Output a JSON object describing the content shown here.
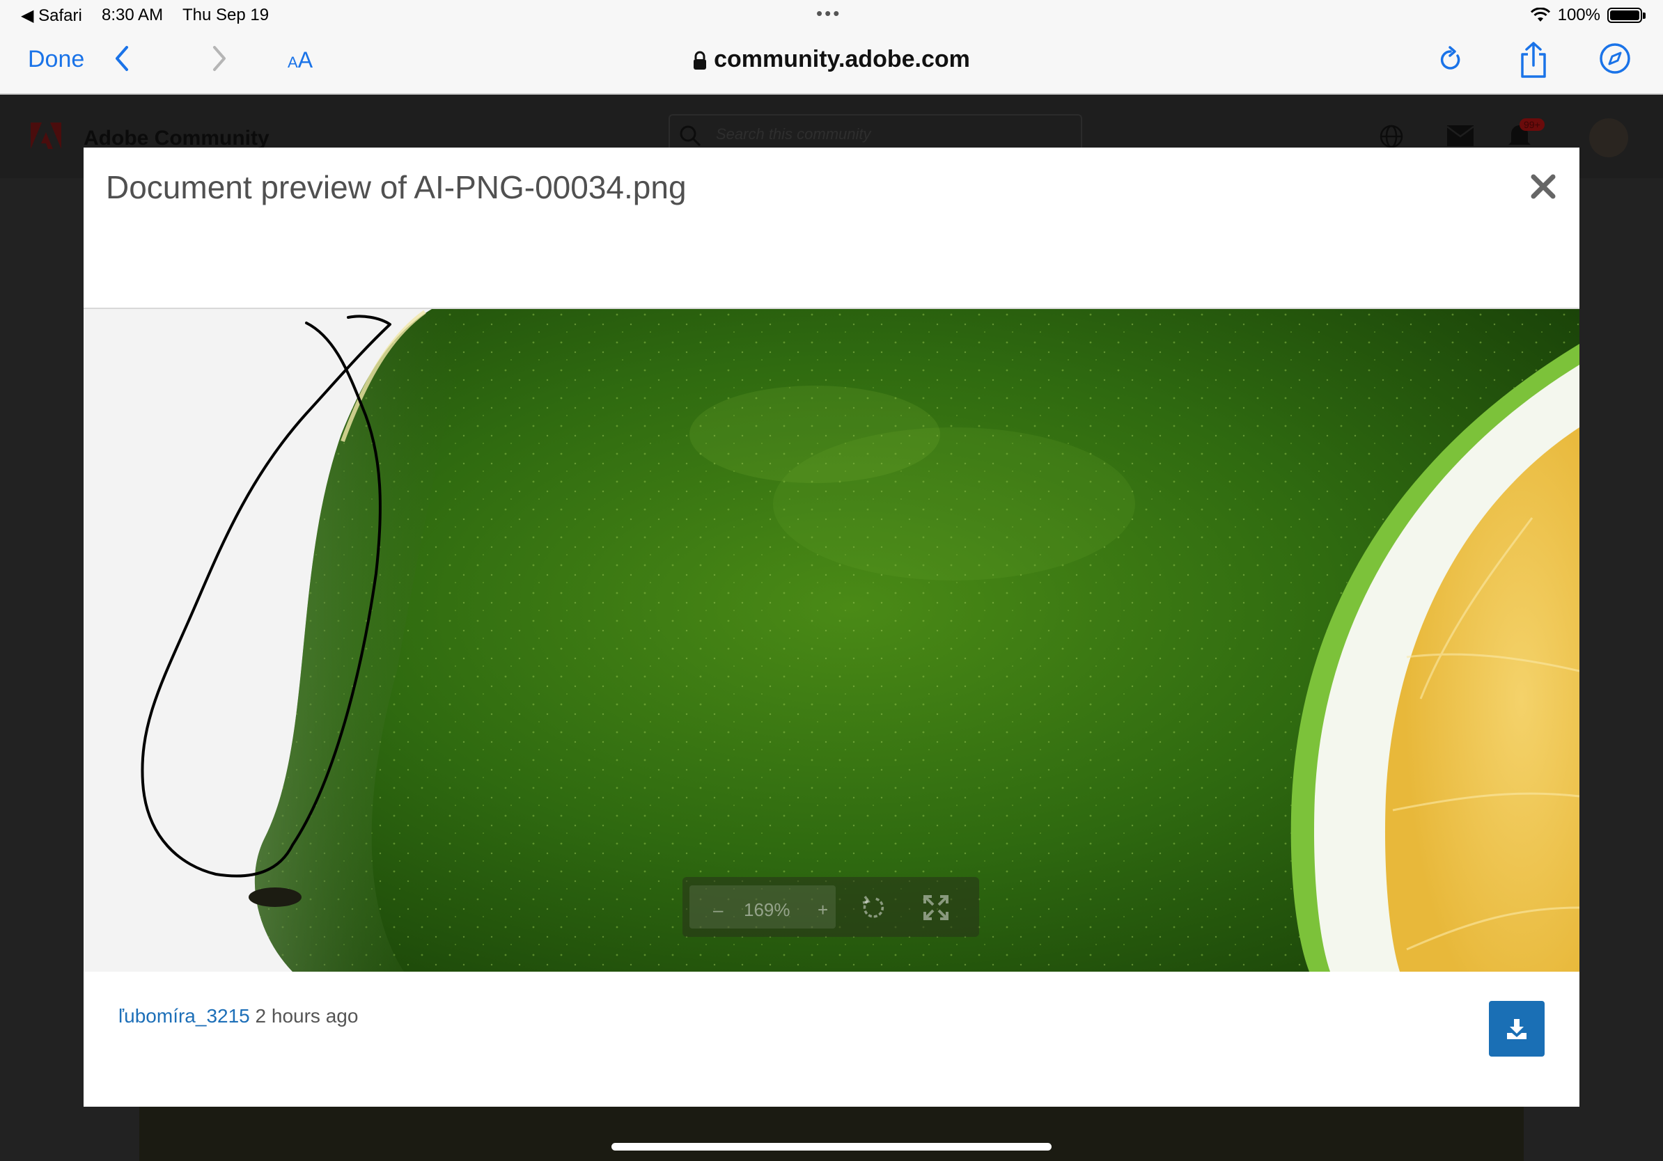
{
  "status_bar": {
    "back_app": "◀ Safari",
    "time": "8:30 AM",
    "date": "Thu Sep 19",
    "battery": "100%",
    "battery_level": 1.0
  },
  "browser": {
    "done_label": "Done",
    "text_size_label_small": "A",
    "text_size_label_large": "A",
    "url": "community.adobe.com",
    "icons": [
      "back-chevron-icon",
      "forward-chevron-icon",
      "lock-icon",
      "reload-icon",
      "share-icon",
      "compass-icon"
    ]
  },
  "background_page": {
    "site_title": "Adobe Community",
    "search_placeholder": "Search this community",
    "notification_badge": "99+"
  },
  "modal": {
    "title": "Document preview of AI-PNG-00034.png",
    "viewer": {
      "zoom_out_label": "–",
      "zoom_level": "169%",
      "zoom_in_label": "+"
    },
    "author": "ľubomíra_3215",
    "posted": "2 hours ago"
  },
  "colors": {
    "link_blue": "#1d6fb8",
    "ios_blue": "#1a73e8",
    "download_button": "#1a6fb5"
  }
}
